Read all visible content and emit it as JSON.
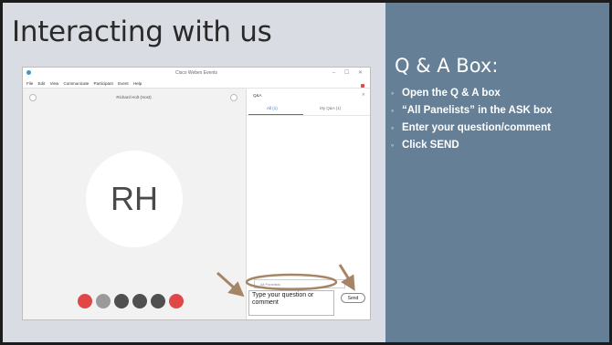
{
  "slide": {
    "title": "Interacting with us"
  },
  "panel": {
    "heading": "Q & A Box:",
    "bullet_glyph": "◦",
    "steps": [
      "Open the Q & A box",
      "“All Panelists” in the ASK box",
      "Enter your question/comment",
      "Click SEND"
    ]
  },
  "webex": {
    "window_title": "Cisco Webex Events",
    "window_controls": "– ☐ ✕",
    "menu": [
      "File",
      "Edit",
      "View",
      "Communicate",
      "Participant",
      "Event",
      "Help"
    ],
    "presenter_name": "Richard Holt (Host)",
    "avatar_initials": "RH",
    "qa_title": "Q&A",
    "qa_tabs": [
      "All (1)",
      "My Q&A (1)"
    ],
    "ask_field": "All Panelists",
    "question_placeholder": "Type your question or comment",
    "send_label": "Send"
  },
  "colors": {
    "right_panel": "#647f96",
    "arrow": "#a58565",
    "mute_button": "#e04848",
    "end_button": "#e04848",
    "control_gray": "#9a9a9a",
    "control_dark": "#505050"
  }
}
